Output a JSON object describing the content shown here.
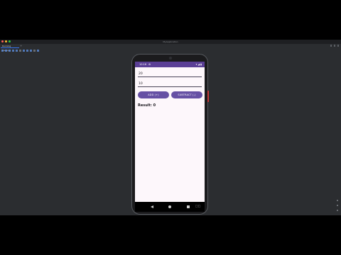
{
  "ide": {
    "window_title": "MyApplication",
    "tab_label": "Running Devices",
    "tab_add": "+",
    "window_dot_colors": [
      "#ff5f57",
      "#febc2e",
      "#28c840"
    ]
  },
  "phone": {
    "status": {
      "time": "10:16",
      "gear": "⚙",
      "wifi": "▾",
      "signal": "◢",
      "battery": "▮"
    },
    "inputs": {
      "first_value": "20",
      "second_value": "10"
    },
    "buttons": {
      "add_label": "ADD (+)",
      "subtract_label": "SUBTRACT (-)"
    },
    "result_text": "Result: 0",
    "nav_extra": "□□",
    "colors": {
      "status_bar": "#5b3f96",
      "button": "#6650a4",
      "screen_bg": "#fdf7fb"
    }
  }
}
